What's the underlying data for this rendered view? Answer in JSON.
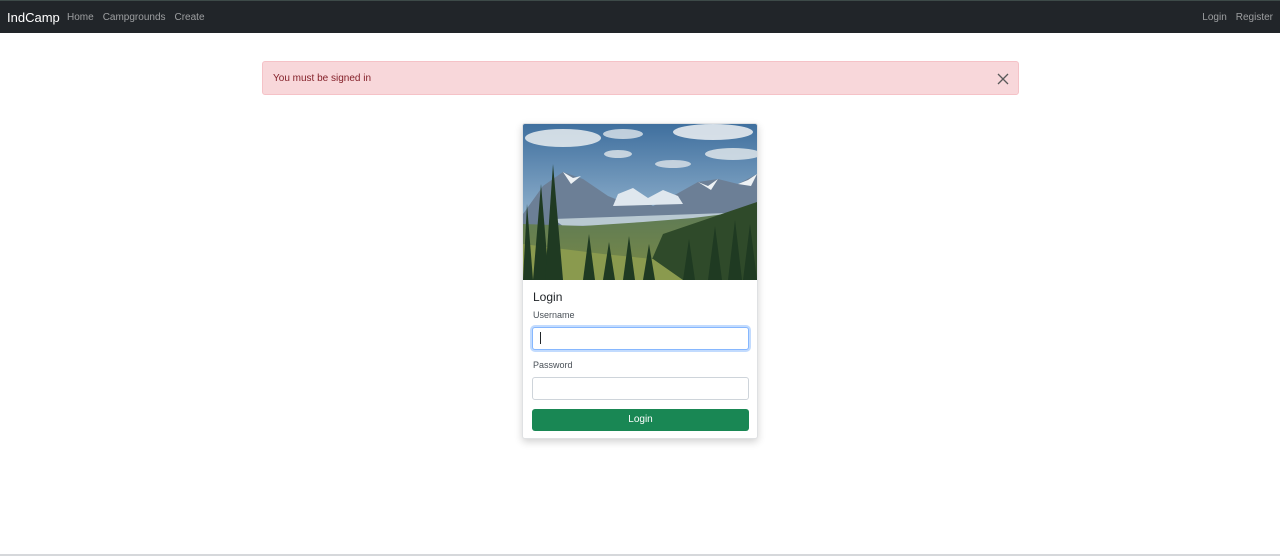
{
  "navbar": {
    "brand": "IndCamp",
    "left_links": [
      "Home",
      "Campgrounds",
      "Create"
    ],
    "right_links": [
      "Login",
      "Register"
    ]
  },
  "alert": {
    "message": "You must be signed in"
  },
  "login_card": {
    "title": "Login",
    "username_label": "Username",
    "username_value": "",
    "password_label": "Password",
    "password_value": "",
    "submit_label": "Login"
  },
  "colors": {
    "navbar_bg": "#212529",
    "alert_bg": "#f8d7da",
    "alert_text": "#842029",
    "submit_bg": "#198754"
  },
  "icons": {
    "alert_close": "close-icon"
  }
}
